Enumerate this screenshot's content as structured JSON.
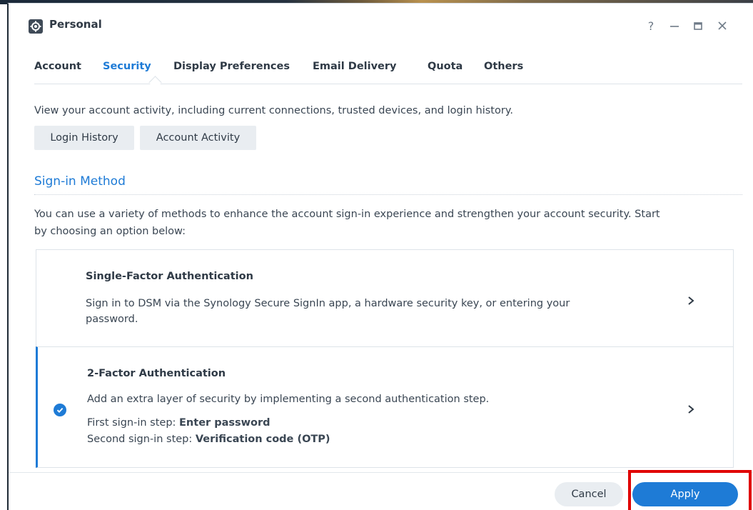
{
  "window": {
    "title": "Personal",
    "controls": [
      "help-icon",
      "minimize-icon",
      "maximize-icon",
      "close-icon"
    ],
    "help_glyph": "?"
  },
  "tabs": [
    {
      "label": "Account",
      "active": false
    },
    {
      "label": "Security",
      "active": true
    },
    {
      "label": "Display Preferences",
      "active": false
    },
    {
      "label": "Email Delivery",
      "active": false
    },
    {
      "label": "Quota",
      "active": false
    },
    {
      "label": "Others",
      "active": false
    }
  ],
  "activity": {
    "description": "View your account activity, including current connections, trusted devices, and login history.",
    "login_history_label": "Login History",
    "account_activity_label": "Account Activity"
  },
  "sign_in": {
    "section_title": "Sign-in Method",
    "intro_line1": "You can use a variety of methods to enhance the account sign-in experience and strengthen your account security. Start",
    "intro_line2": "by choosing an option below:",
    "options": [
      {
        "title": "Single-Factor Authentication",
        "desc_line1": "Sign in to DSM via the Synology Secure SignIn app, a hardware security key, or entering your",
        "desc_line2": "password.",
        "selected": false
      },
      {
        "title": "2-Factor Authentication",
        "desc_line1": "Add an extra layer of security by implementing a second authentication step.",
        "step1_label": "First sign-in step: ",
        "step1_value": "Enter password",
        "step2_label": "Second sign-in step: ",
        "step2_value": "Verification code (OTP)",
        "selected": true
      }
    ]
  },
  "footer": {
    "cancel_label": "Cancel",
    "apply_label": "Apply"
  },
  "colors": {
    "accent": "#1e7bd6",
    "highlight": "#e00000"
  }
}
